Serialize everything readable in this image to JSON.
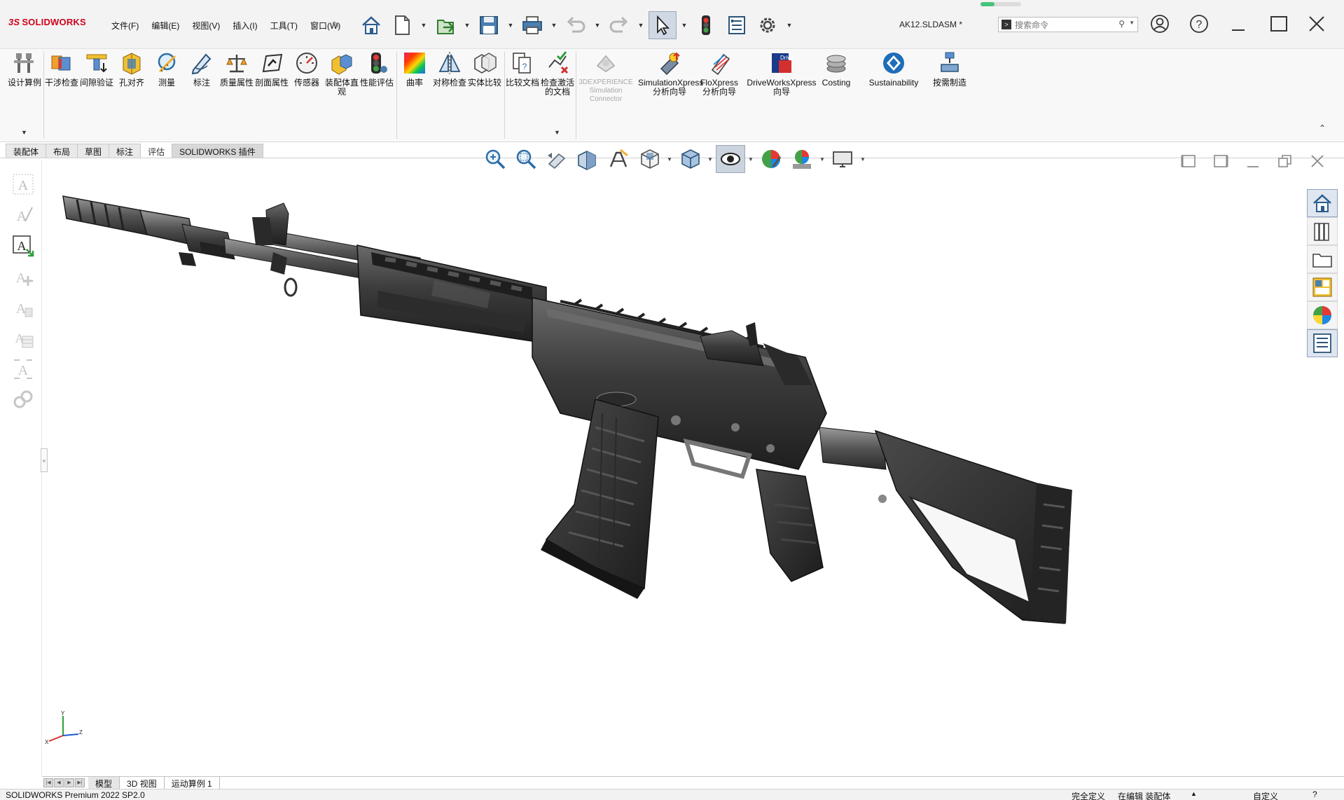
{
  "app": {
    "brand": "SOLIDWORKS",
    "document_title": "AK12.SLDASM *",
    "menus": [
      "文件(F)",
      "编辑(E)",
      "视图(V)",
      "插入(I)",
      "工具(T)",
      "窗口(W)"
    ],
    "search_placeholder": "搜索命令"
  },
  "quick_access": [
    "home-icon",
    "new-document-icon",
    "open-icon",
    "save-icon",
    "print-icon",
    "undo-icon",
    "redo-icon",
    "select-icon",
    "traffic-light-icon",
    "file-properties-icon",
    "options-icon"
  ],
  "ribbon": {
    "buttons": [
      {
        "label": "设计算例",
        "icon": "design-study-icon"
      },
      {
        "label": "干涉检查",
        "icon": "interference-check-icon"
      },
      {
        "label": "间隙验证",
        "icon": "clearance-verification-icon"
      },
      {
        "label": "孔对齐",
        "icon": "hole-alignment-icon"
      },
      {
        "label": "测量",
        "icon": "measure-icon"
      },
      {
        "label": "标注",
        "icon": "markup-icon"
      },
      {
        "label": "质量属性",
        "icon": "mass-properties-icon"
      },
      {
        "label": "剖面属性",
        "icon": "section-properties-icon"
      },
      {
        "label": "传感器",
        "icon": "sensor-icon"
      },
      {
        "label": "装配体直观",
        "icon": "assembly-visualization-icon"
      },
      {
        "label": "性能评估",
        "icon": "performance-evaluation-icon"
      },
      {
        "label": "曲率",
        "icon": "curvature-icon"
      },
      {
        "label": "对称检查",
        "icon": "symmetry-check-icon"
      },
      {
        "label": "实体比较",
        "icon": "compare-geometry-icon"
      },
      {
        "label": "比较文档",
        "icon": "compare-documents-icon"
      },
      {
        "label": "检查激活的文档",
        "icon": "check-active-document-icon"
      },
      {
        "label": "3DEXPERIENCE Simulation Connector",
        "icon": "3dexperience-connector-icon",
        "disabled": true
      },
      {
        "label": "SimulationXpress 分析向导",
        "icon": "simulationxpress-icon"
      },
      {
        "label": "FloXpress 分析向导",
        "icon": "floxpress-icon"
      },
      {
        "label": "DriveWorksXpress 向导",
        "icon": "driveworksxpress-icon"
      },
      {
        "label": "Costing",
        "icon": "costing-icon"
      },
      {
        "label": "Sustainability",
        "icon": "sustainability-icon"
      },
      {
        "label": "按需制造",
        "icon": "manufacturing-on-demand-icon"
      }
    ]
  },
  "tabs": [
    {
      "label": "装配体"
    },
    {
      "label": "布局"
    },
    {
      "label": "草图"
    },
    {
      "label": "标注"
    },
    {
      "label": "评估"
    },
    {
      "label": "SOLIDWORKS 插件"
    }
  ],
  "bottom_tabs": [
    "模型",
    "3D 视图",
    "运动算例 1"
  ],
  "status": {
    "product": "SOLIDWORKS Premium 2022 SP2.0",
    "definition": "完全定义",
    "editing": "在编辑 装配体",
    "custom": "自定义"
  },
  "colors": {
    "brand_red": "#d0021b",
    "model_gray": "#3a3a3a",
    "active_tab": "#d8d8d8"
  }
}
